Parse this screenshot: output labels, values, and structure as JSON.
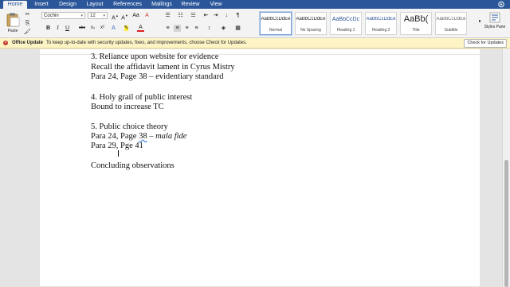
{
  "tabs": [
    "Home",
    "Insert",
    "Design",
    "Layout",
    "References",
    "Mailings",
    "Review",
    "View"
  ],
  "ribbon": {
    "paste_label": "Paste",
    "font_name": "Cochin",
    "font_size": "12",
    "styles": [
      {
        "preview": "AaBbCcDdEe",
        "name": "Normal"
      },
      {
        "preview": "AaBbCcDdEe",
        "name": "No Spacing"
      },
      {
        "preview": "AaBbCcDc",
        "name": "Heading 1"
      },
      {
        "preview": "AaBbCcDdEe",
        "name": "Heading 2"
      },
      {
        "preview": "AaBb(",
        "name": "Title"
      },
      {
        "preview": "AaBbCcDdEe",
        "name": "Subtitle"
      }
    ],
    "styles_pane_label": "Styles Pane"
  },
  "info_bar": {
    "title": "Office Update",
    "message": "To keep up-to-date with security updates, fixes, and improvements, choose Check for Updates.",
    "button": "Check for Updates"
  },
  "document": {
    "lines": [
      "3. Reliance upon website for evidence",
      "Recall the affidavit lament in Cyrus Mistry",
      "Para 24, Page 38 – evidentiary standard",
      "",
      "4. Holy grail of public interest",
      "Bound to increase TC",
      "",
      "5. Public choice theory",
      "",
      "Para 29, Pge 41",
      "",
      "Concluding observations"
    ],
    "line8_prefix": "Para 24, Page ",
    "line8_underlined": "38",
    "line8_dash": " – ",
    "line8_italic": "mala fide"
  }
}
